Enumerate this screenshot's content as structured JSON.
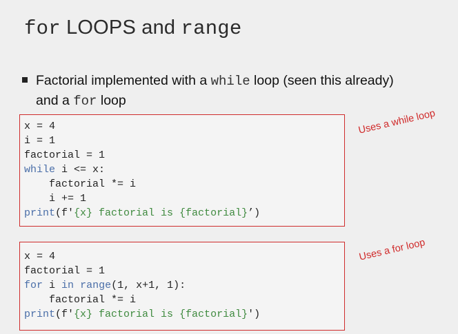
{
  "slide": {
    "title": {
      "part1": "for",
      "part2": " LOOPS and ",
      "part3": "range"
    },
    "bullet": {
      "t1": "Factorial implemented with a ",
      "k1": "while",
      "t2": " loop (seen this already)",
      "t3": "and a ",
      "k2": "for",
      "t4": " loop"
    },
    "code_while": {
      "l1": "x = 4",
      "l2": "i = 1",
      "l3": "factorial = 1",
      "l4_kw": "while",
      "l4_rest": " i <= x:",
      "l5": "    factorial *= i",
      "l6": "    i += 1",
      "l7_fn": "print",
      "l7_a": "(f'",
      "l7_str": "{x} factorial is {factorial}",
      "l7_b": "’)"
    },
    "code_for": {
      "l1": "x = 4",
      "l2": "factorial = 1",
      "l3_kw1": "for",
      "l3_a": " i ",
      "l3_kw2": "in",
      "l3_b": " ",
      "l3_fn": "range",
      "l3_c": "(1, x+1, 1):",
      "l4": "    factorial *= i",
      "l5_fn": "print",
      "l5_a": "(f'",
      "l5_str": "{x} factorial is {factorial}",
      "l5_b": "')"
    },
    "notes": {
      "while": "Uses a while loop",
      "for": "Uses a for loop"
    }
  },
  "colors": {
    "background": "#efefef",
    "box_border": "#cf2b2b",
    "note_text": "#d02a2a",
    "keyword": "#4a6ea8",
    "string": "#3f8a3f"
  }
}
